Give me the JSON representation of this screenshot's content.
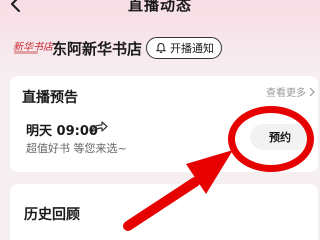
{
  "nav": {
    "title": "直播动态",
    "back_icon": "chevron-left-icon"
  },
  "store": {
    "logo_text": "新华书店",
    "name": "东阿新华书店",
    "notify_label": "开播通知",
    "notify_icon": "bell-icon"
  },
  "preview": {
    "title": "直播预告",
    "see_more": "查看更多",
    "time": "明天 09:00",
    "share_icon": "share-arrow-icon",
    "description": "超值好书 等您来选~",
    "reserve_label": "预约"
  },
  "history": {
    "title": "历史回顾"
  },
  "annotation": {
    "color": "#e60000"
  }
}
